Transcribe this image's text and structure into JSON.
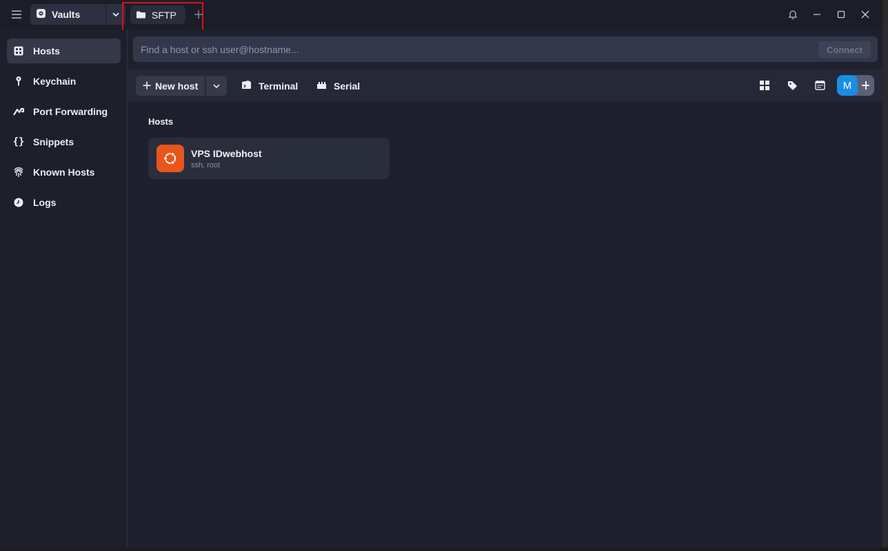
{
  "titlebar": {
    "vaults_label": "Vaults",
    "tabs": [
      {
        "label": "SFTP",
        "icon": "folder-icon"
      }
    ]
  },
  "sidebar": {
    "items": [
      {
        "label": "Hosts",
        "icon": "hosts-grid-icon",
        "active": true
      },
      {
        "label": "Keychain",
        "icon": "key-icon"
      },
      {
        "label": "Port Forwarding",
        "icon": "port-forward-icon"
      },
      {
        "label": "Snippets",
        "icon": "braces-icon"
      },
      {
        "label": "Known Hosts",
        "icon": "fingerprint-icon"
      },
      {
        "label": "Logs",
        "icon": "clock-icon"
      }
    ]
  },
  "search": {
    "placeholder": "Find a host or ssh user@hostname...",
    "connect_label": "Connect"
  },
  "toolbar": {
    "new_host_label": "New host",
    "terminal_label": "Terminal",
    "serial_label": "Serial",
    "avatar_initial": "M"
  },
  "hosts": {
    "section_title": "Hosts",
    "items": [
      {
        "name": "VPS IDwebhost",
        "details": "ssh, root",
        "os_icon": "ubuntu-icon"
      }
    ]
  },
  "colors": {
    "accent": "#1c8de3",
    "ubuntu": "#e9561c",
    "highlight": "#e0101c"
  }
}
